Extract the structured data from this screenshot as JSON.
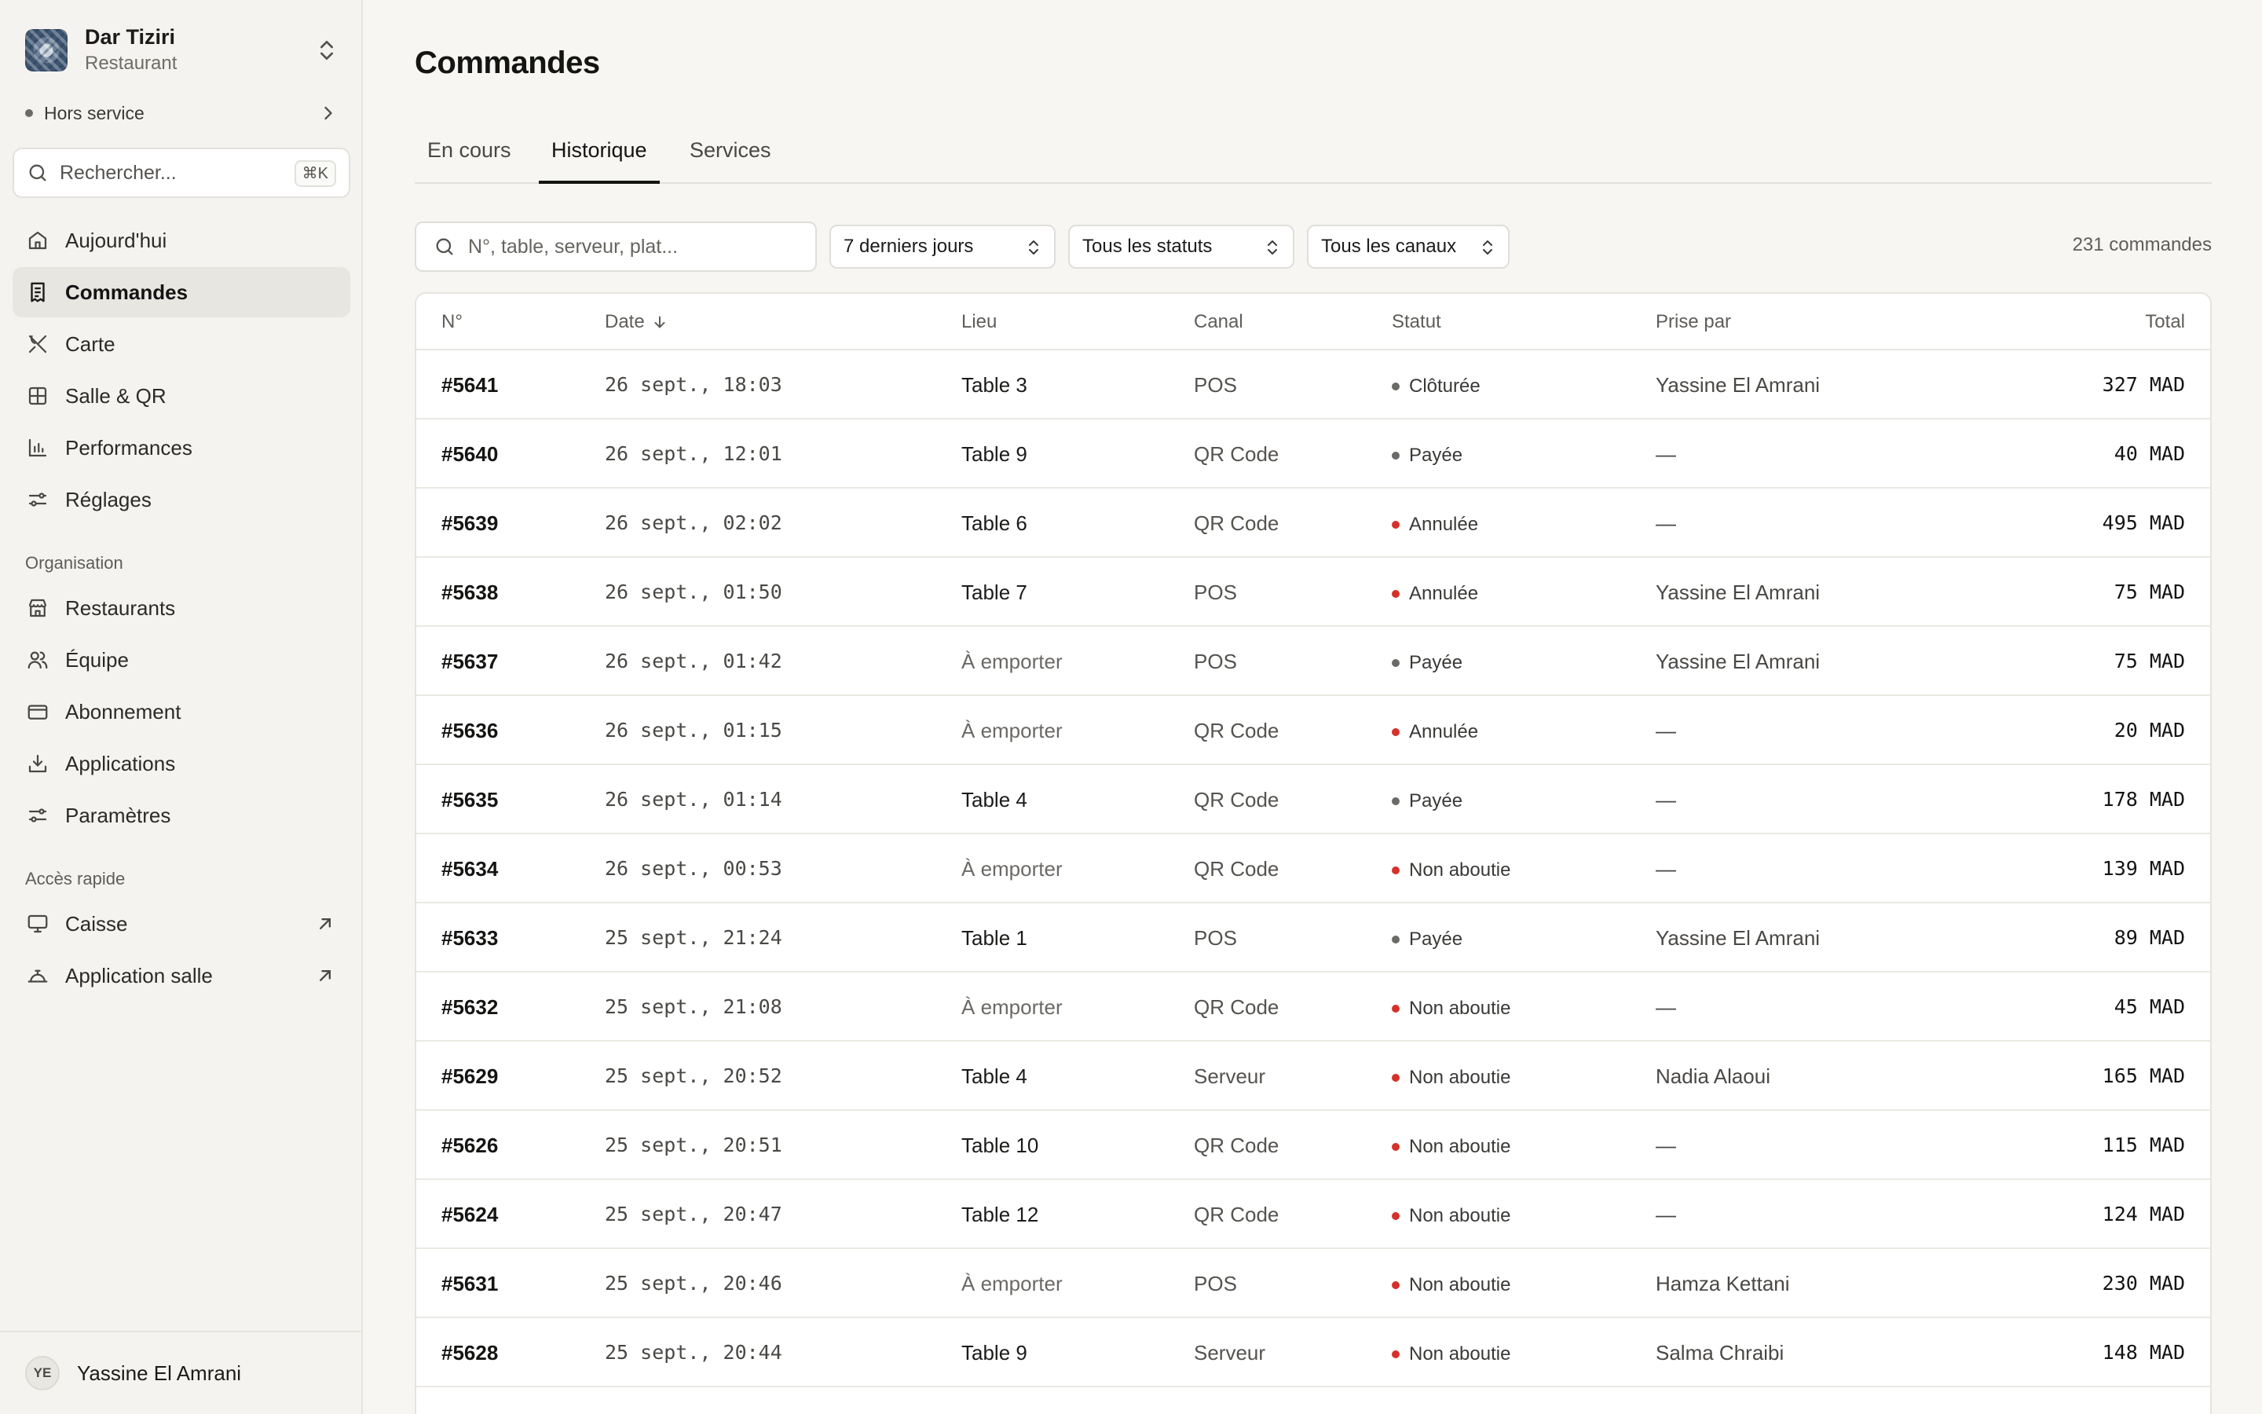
{
  "brand": {
    "name": "Dar Tiziri",
    "subtitle": "Restaurant"
  },
  "service_status": "Hors service",
  "sidebar_search": {
    "placeholder": "Rechercher...",
    "shortcut": "⌘K"
  },
  "nav": [
    {
      "label": "Aujourd'hui",
      "icon": "home-icon"
    },
    {
      "label": "Commandes",
      "icon": "receipt-icon",
      "active": true
    },
    {
      "label": "Carte",
      "icon": "utensils-icon"
    },
    {
      "label": "Salle & QR",
      "icon": "grid-icon"
    },
    {
      "label": "Performances",
      "icon": "bar-chart-icon"
    },
    {
      "label": "Réglages",
      "icon": "sliders-icon"
    }
  ],
  "organisation": {
    "label": "Organisation",
    "items": [
      {
        "label": "Restaurants",
        "icon": "store-icon"
      },
      {
        "label": "Équipe",
        "icon": "users-icon"
      },
      {
        "label": "Abonnement",
        "icon": "credit-card-icon"
      },
      {
        "label": "Applications",
        "icon": "download-icon"
      },
      {
        "label": "Paramètres",
        "icon": "settings-sliders-icon"
      }
    ]
  },
  "quick_access": {
    "label": "Accès rapide",
    "items": [
      {
        "label": "Caisse",
        "icon": "monitor-icon"
      },
      {
        "label": "Application salle",
        "icon": "cloche-icon"
      }
    ]
  },
  "user": {
    "initials": "YE",
    "name": "Yassine El Amrani"
  },
  "page": {
    "title": "Commandes"
  },
  "tabs": [
    {
      "label": "En cours"
    },
    {
      "label": "Historique",
      "active": true
    },
    {
      "label": "Services"
    }
  ],
  "filters": {
    "search_placeholder": "N°, table, serveur, plat...",
    "period": "7 derniers jours",
    "status": "Tous les statuts",
    "channel": "Tous les canaux",
    "count": "231 commandes"
  },
  "table": {
    "headers": {
      "num": "N°",
      "date": "Date",
      "lieu": "Lieu",
      "canal": "Canal",
      "statut": "Statut",
      "prise": "Prise par",
      "total": "Total"
    },
    "rows": [
      {
        "num": "#5641",
        "date": "26 sept., 18:03",
        "lieu": "Table 3",
        "canal": "POS",
        "statut": "Clôturée",
        "prise": "Yassine El Amrani",
        "total": "327 MAD"
      },
      {
        "num": "#5640",
        "date": "26 sept., 12:01",
        "lieu": "Table 9",
        "canal": "QR Code",
        "statut": "Payée",
        "prise": "—",
        "total": "40 MAD"
      },
      {
        "num": "#5639",
        "date": "26 sept., 02:02",
        "lieu": "Table 6",
        "canal": "QR Code",
        "statut": "Annulée",
        "prise": "—",
        "total": "495 MAD"
      },
      {
        "num": "#5638",
        "date": "26 sept., 01:50",
        "lieu": "Table 7",
        "canal": "POS",
        "statut": "Annulée",
        "prise": "Yassine El Amrani",
        "total": "75 MAD"
      },
      {
        "num": "#5637",
        "date": "26 sept., 01:42",
        "lieu": "À emporter",
        "canal": "POS",
        "statut": "Payée",
        "prise": "Yassine El Amrani",
        "total": "75 MAD"
      },
      {
        "num": "#5636",
        "date": "26 sept., 01:15",
        "lieu": "À emporter",
        "canal": "QR Code",
        "statut": "Annulée",
        "prise": "—",
        "total": "20 MAD"
      },
      {
        "num": "#5635",
        "date": "26 sept., 01:14",
        "lieu": "Table 4",
        "canal": "QR Code",
        "statut": "Payée",
        "prise": "—",
        "total": "178 MAD"
      },
      {
        "num": "#5634",
        "date": "26 sept., 00:53",
        "lieu": "À emporter",
        "canal": "QR Code",
        "statut": "Non aboutie",
        "prise": "—",
        "total": "139 MAD"
      },
      {
        "num": "#5633",
        "date": "25 sept., 21:24",
        "lieu": "Table 1",
        "canal": "POS",
        "statut": "Payée",
        "prise": "Yassine El Amrani",
        "total": "89 MAD"
      },
      {
        "num": "#5632",
        "date": "25 sept., 21:08",
        "lieu": "À emporter",
        "canal": "QR Code",
        "statut": "Non aboutie",
        "prise": "—",
        "total": "45 MAD"
      },
      {
        "num": "#5629",
        "date": "25 sept., 20:52",
        "lieu": "Table 4",
        "canal": "Serveur",
        "statut": "Non aboutie",
        "prise": "Nadia Alaoui",
        "total": "165 MAD"
      },
      {
        "num": "#5626",
        "date": "25 sept., 20:51",
        "lieu": "Table 10",
        "canal": "QR Code",
        "statut": "Non aboutie",
        "prise": "—",
        "total": "115 MAD"
      },
      {
        "num": "#5624",
        "date": "25 sept., 20:47",
        "lieu": "Table 12",
        "canal": "QR Code",
        "statut": "Non aboutie",
        "prise": "—",
        "total": "124 MAD"
      },
      {
        "num": "#5631",
        "date": "25 sept., 20:46",
        "lieu": "À emporter",
        "canal": "POS",
        "statut": "Non aboutie",
        "prise": "Hamza Kettani",
        "total": "230 MAD"
      },
      {
        "num": "#5628",
        "date": "25 sept., 20:44",
        "lieu": "Table 9",
        "canal": "Serveur",
        "statut": "Non aboutie",
        "prise": "Salma Chraibi",
        "total": "148 MAD"
      }
    ]
  },
  "colors": {
    "status_grey": "#6c6a66",
    "status_red": "#d4312a",
    "accent": "#141413"
  }
}
